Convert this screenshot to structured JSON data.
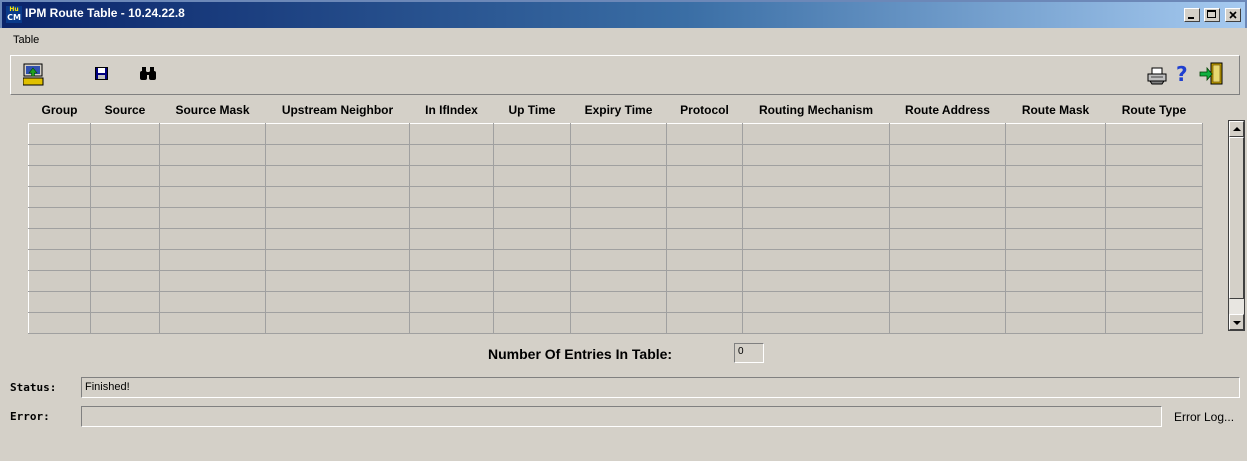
{
  "window": {
    "title": "IPM Route Table - 10.24.22.8",
    "app_icon_text_top": "Hu",
    "app_icon_text_bottom": "CM",
    "controls": [
      "minimize",
      "maximize",
      "close"
    ]
  },
  "menubar": {
    "items": [
      "Table"
    ]
  },
  "toolbar": {
    "left_icons": [
      "load-icon",
      "save-icon",
      "find-icon"
    ],
    "right_icons": [
      "print-icon",
      "help-icon",
      "exit-icon"
    ],
    "help_glyph": "?"
  },
  "table": {
    "columns": [
      "Group",
      "Source",
      "Source Mask",
      "Upstream Neighbor",
      "In IfIndex",
      "Up Time",
      "Expiry Time",
      "Protocol",
      "Routing Mechanism",
      "Route Address",
      "Route Mask",
      "Route Type"
    ],
    "rows": []
  },
  "entries": {
    "label": "Number Of Entries In Table:",
    "value": "0"
  },
  "status": {
    "label": "Status:",
    "value": "Finished!"
  },
  "error": {
    "label": "Error:",
    "value": "",
    "log_link": "Error Log..."
  },
  "colors": {
    "title_start": "#0a246a",
    "title_end": "#a6caf0",
    "face": "#d4d0c8"
  }
}
